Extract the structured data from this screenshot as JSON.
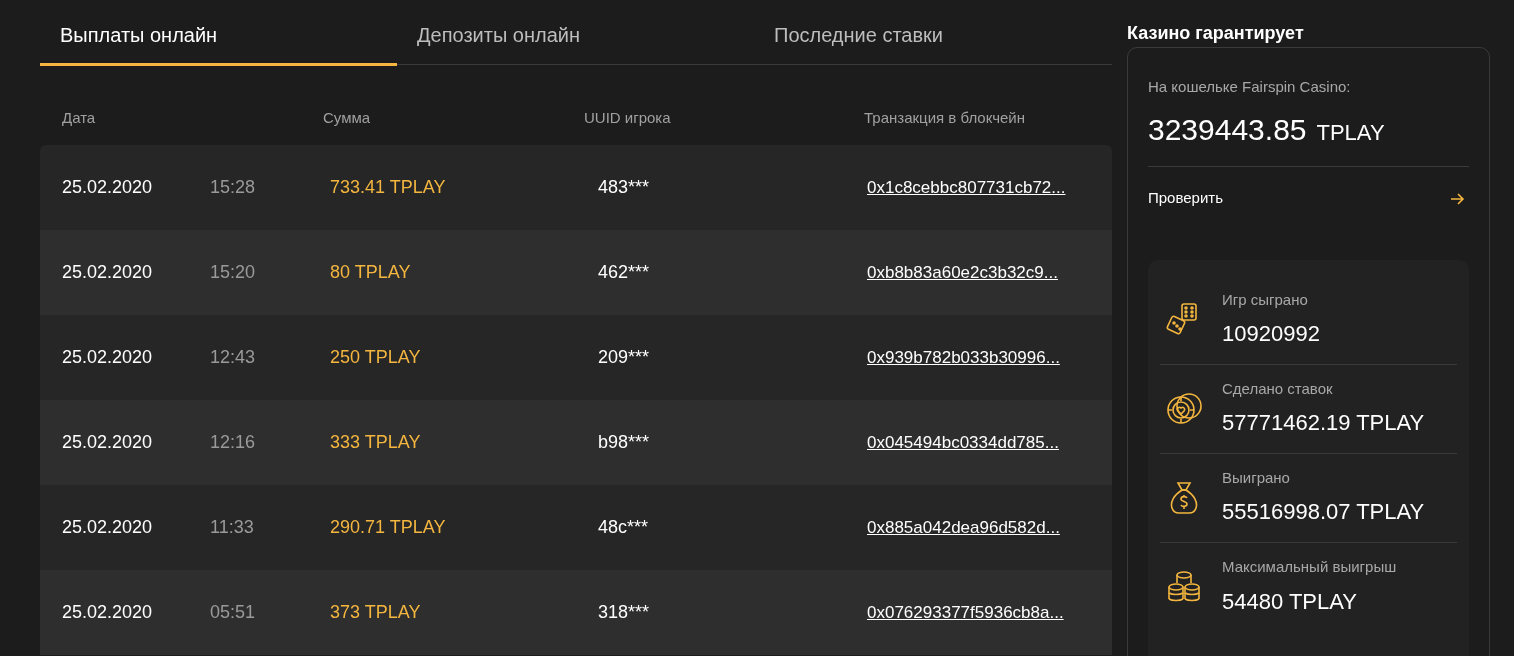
{
  "tabs": [
    {
      "label": "Выплаты онлайн",
      "selected": true
    },
    {
      "label": "Депозиты онлайн",
      "selected": false
    },
    {
      "label": "Последние ставки",
      "selected": false
    }
  ],
  "table": {
    "columns": [
      "Дата",
      "Сумма",
      "UUID игрока",
      "Транзакция в блокчейн"
    ],
    "rows": [
      {
        "date": "25.02.2020",
        "time": "15:28",
        "amount": "733.41 TPLAY",
        "uuid": "483***",
        "tx": "0x1c8cebbc807731cb72..."
      },
      {
        "date": "25.02.2020",
        "time": "15:20",
        "amount": "80 TPLAY",
        "uuid": "462***",
        "tx": "0xb8b83a60e2c3b32c9..."
      },
      {
        "date": "25.02.2020",
        "time": "12:43",
        "amount": "250 TPLAY",
        "uuid": "209***",
        "tx": "0x939b782b033b30996..."
      },
      {
        "date": "25.02.2020",
        "time": "12:16",
        "amount": "333 TPLAY",
        "uuid": "b98***",
        "tx": "0x045494bc0334dd785..."
      },
      {
        "date": "25.02.2020",
        "time": "11:33",
        "amount": "290.71 TPLAY",
        "uuid": "48c***",
        "tx": "0x885a042dea96d582d..."
      },
      {
        "date": "25.02.2020",
        "time": "05:51",
        "amount": "373 TPLAY",
        "uuid": "318***",
        "tx": "0x076293377f5936cb8a..."
      }
    ]
  },
  "guarantee": {
    "title": "Казино гарантирует",
    "wallet_label": "На кошельке Fairspin Casino:",
    "wallet_amount": "3239443.85",
    "wallet_currency": "TPLAY",
    "check_link": "Проверить",
    "stats": [
      {
        "kind": "dice",
        "label": "Игр сыграно",
        "value": "10920992"
      },
      {
        "kind": "chips",
        "label": "Сделано ставок",
        "value": "57771462.19 TPLAY"
      },
      {
        "kind": "moneybag",
        "label": "Выиграно",
        "value": "55516998.07 TPLAY"
      },
      {
        "kind": "coins",
        "label": "Максимальный выигрыш",
        "value": "54480 TPLAY"
      }
    ]
  }
}
